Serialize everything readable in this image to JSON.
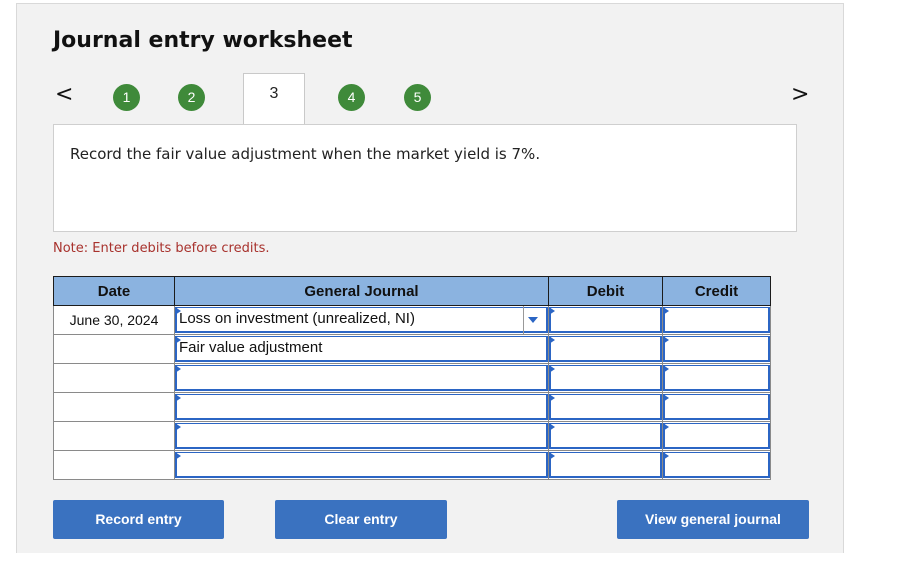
{
  "title": "Journal entry worksheet",
  "nav": {
    "prev_icon": "chevron-left-icon",
    "next_icon": "chevron-right-icon",
    "prev_glyph": "<",
    "next_glyph": ">",
    "steps": [
      "1",
      "2",
      "3",
      "4",
      "5"
    ],
    "active_step": "3"
  },
  "instruction": "Record the fair value adjustment when the market yield is 7%.",
  "note": "Note: Enter debits before credits.",
  "table": {
    "headers": {
      "date": "Date",
      "account": "General Journal",
      "debit": "Debit",
      "credit": "Credit"
    },
    "rows": [
      {
        "date": "June 30, 2024",
        "account": "Loss on investment (unrealized, NI)",
        "debit": "",
        "credit": ""
      },
      {
        "date": "",
        "account": "Fair value adjustment",
        "debit": "",
        "credit": ""
      },
      {
        "date": "",
        "account": "",
        "debit": "",
        "credit": ""
      },
      {
        "date": "",
        "account": "",
        "debit": "",
        "credit": ""
      },
      {
        "date": "",
        "account": "",
        "debit": "",
        "credit": ""
      },
      {
        "date": "",
        "account": "",
        "debit": "",
        "credit": ""
      }
    ]
  },
  "buttons": {
    "record": "Record entry",
    "clear": "Clear entry",
    "view": "View general journal"
  },
  "colors": {
    "step_green": "#3f8a3a",
    "header_blue": "#8bb3e0",
    "button_blue": "#3a72c0",
    "note_red": "#a8322d"
  }
}
